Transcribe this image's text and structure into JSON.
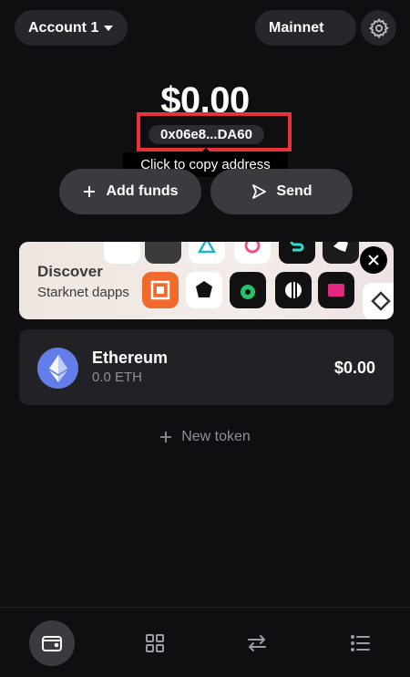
{
  "header": {
    "account_label": "Account 1",
    "network_label": "Mainnet"
  },
  "wallet": {
    "balance": "$0.00",
    "address": "0x06e8...DA60",
    "copy_tooltip": "Click to copy address"
  },
  "actions": {
    "add_funds_label": "Add funds",
    "send_label": "Send"
  },
  "discover_banner": {
    "title": "Discover",
    "subtitle": "Starknet dapps"
  },
  "tokens": [
    {
      "name": "Ethereum",
      "amount": "0.0 ETH",
      "value": "$0.00",
      "icon": "ethereum-icon"
    }
  ],
  "new_token_label": "New token",
  "bottom_nav": [
    "wallet-icon",
    "apps-grid-icon",
    "swap-arrows-icon",
    "activity-list-icon"
  ],
  "colors": {
    "background": "#0f0f12",
    "highlight": "#e8323a",
    "ethereum": "#627eea"
  }
}
